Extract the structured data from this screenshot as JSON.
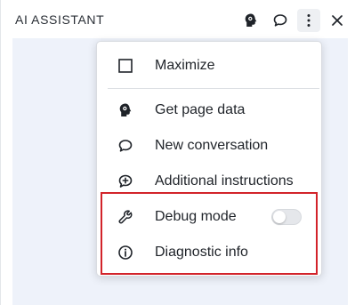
{
  "header": {
    "title": "AI ASSISTANT",
    "icons": [
      "brain-icon",
      "chat-bubble-icon",
      "more-vertical-icon",
      "close-icon"
    ]
  },
  "menu": {
    "items": [
      {
        "label": "Maximize",
        "icon": "maximize-square-icon"
      },
      {
        "label": "Get page data",
        "icon": "brain-icon"
      },
      {
        "label": "New conversation",
        "icon": "chat-bubble-icon"
      },
      {
        "label": "Additional instructions",
        "icon": "chat-plus-icon"
      },
      {
        "label": "Debug mode",
        "icon": "wrench-icon",
        "toggle": false
      },
      {
        "label": "Diagnostic info",
        "icon": "info-icon"
      }
    ]
  },
  "colors": {
    "highlight": "#d2232a",
    "content_bg": "#eef2fa"
  }
}
